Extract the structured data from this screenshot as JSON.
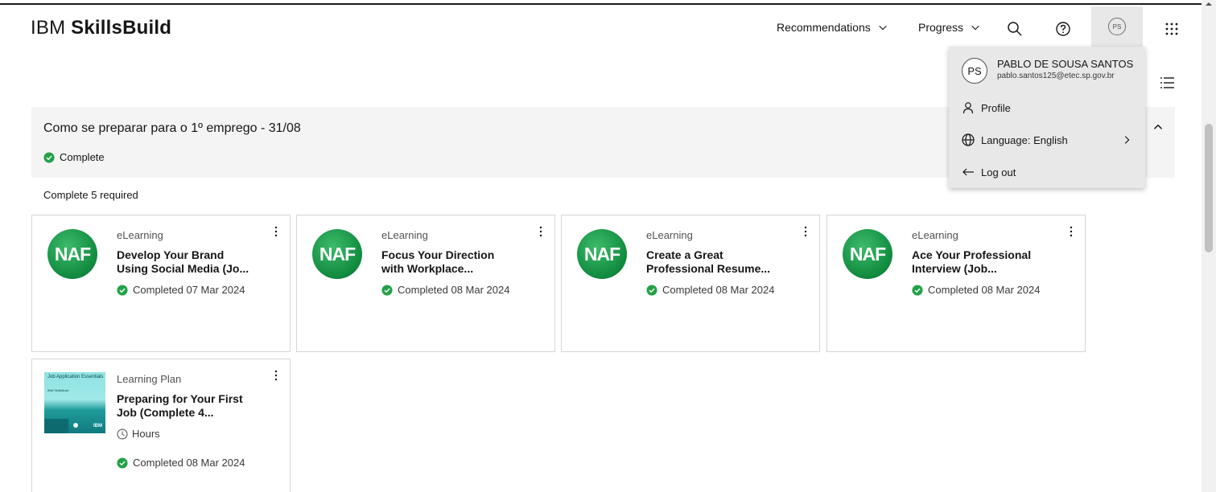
{
  "brand": {
    "prefix": "IBM",
    "name": "SkillsBuild"
  },
  "nav": {
    "recommendations": "Recommendations",
    "progress": "Progress",
    "avatar_initials": "PS"
  },
  "section": {
    "title": "Como se preparar para o 1º emprego - 31/08",
    "status": "Complete",
    "required": "Complete 5 required"
  },
  "cards": [
    {
      "type": "eLearning",
      "title_line1": "Develop Your Brand",
      "title_line2": "Using Social Media (Jo...",
      "status": "Completed 07 Mar 2024",
      "thumb": "NAF"
    },
    {
      "type": "eLearning",
      "title_line1": "Focus Your Direction",
      "title_line2": "with Workplace...",
      "status": "Completed 08 Mar 2024",
      "thumb": "NAF"
    },
    {
      "type": "eLearning",
      "title_line1": "Create a Great",
      "title_line2": "Professional Resume...",
      "status": "Completed 08 Mar 2024",
      "thumb": "NAF"
    },
    {
      "type": "eLearning",
      "title_line1": "Ace Your Professional",
      "title_line2": "Interview (Job...",
      "status": "Completed 08 Mar 2024",
      "thumb": "NAF"
    }
  ],
  "plan_card": {
    "type": "Learning Plan",
    "title_line1": "Preparing for Your First",
    "title_line2": "Job (Complete 4...",
    "hours": "Hours",
    "status": "Completed 08 Mar 2024",
    "thumb_title": "Job Application Essentials",
    "thumb_sub": "IBM SkillsBuild",
    "thumb_logo": "IBM"
  },
  "dropdown": {
    "initials": "PS",
    "name": "PABLO DE SOUSA SANTOS",
    "email": "pablo.santos125@etec.sp.gov.br",
    "profile": "Profile",
    "language": "Language: English",
    "logout": "Log out"
  },
  "colors": {
    "accent_green": "#24a148",
    "panel": "#f4f4f4",
    "dropdown_bg": "#e8e8e8"
  }
}
